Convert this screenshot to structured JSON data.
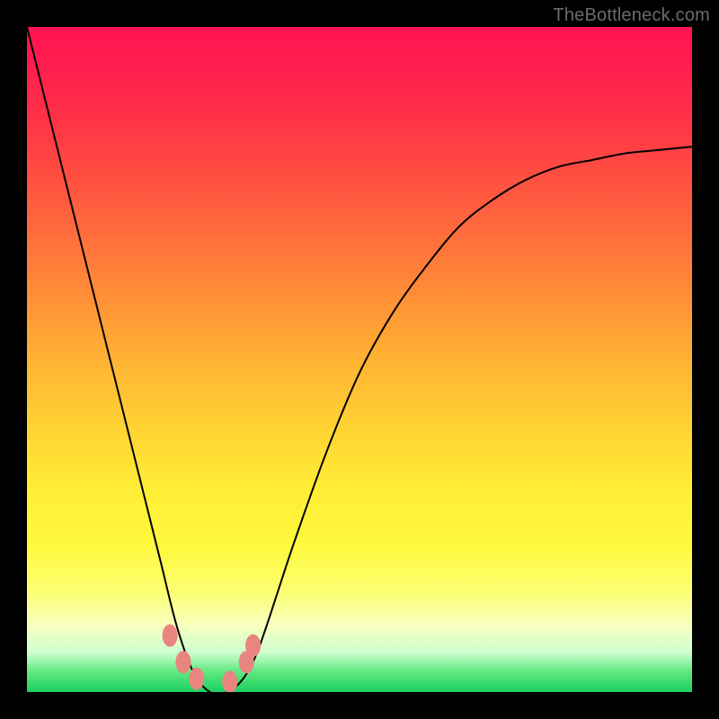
{
  "watermark": "TheBottleneck.com",
  "colors": {
    "frame": "#000000",
    "curve_stroke": "#000000",
    "marker_fill": "#e9857f"
  },
  "chart_data": {
    "type": "line",
    "title": "",
    "xlabel": "",
    "ylabel": "",
    "x": [
      0.0,
      0.05,
      0.1,
      0.15,
      0.2,
      0.225,
      0.25,
      0.275,
      0.3,
      0.325,
      0.35,
      0.4,
      0.45,
      0.5,
      0.55,
      0.6,
      0.65,
      0.7,
      0.75,
      0.8,
      0.85,
      0.9,
      0.95,
      1.0
    ],
    "values": [
      1.0,
      0.8,
      0.6,
      0.4,
      0.2,
      0.1,
      0.03,
      0.0,
      0.0,
      0.02,
      0.07,
      0.22,
      0.36,
      0.48,
      0.57,
      0.64,
      0.7,
      0.74,
      0.77,
      0.79,
      0.8,
      0.81,
      0.815,
      0.82
    ],
    "description": "Asymmetric V-shaped bottleneck curve: height 1.0 implies 100% bottleneck (bad, red), height 0.0 implies 0% bottleneck (good, green). Minimum near x≈0.28.",
    "ylim": [
      0,
      1
    ],
    "xlim": [
      0,
      1
    ],
    "markers": [
      {
        "x": 0.215,
        "y": 0.085
      },
      {
        "x": 0.235,
        "y": 0.045
      },
      {
        "x": 0.255,
        "y": 0.02
      },
      {
        "x": 0.305,
        "y": 0.015
      },
      {
        "x": 0.33,
        "y": 0.045
      },
      {
        "x": 0.34,
        "y": 0.07
      }
    ]
  }
}
